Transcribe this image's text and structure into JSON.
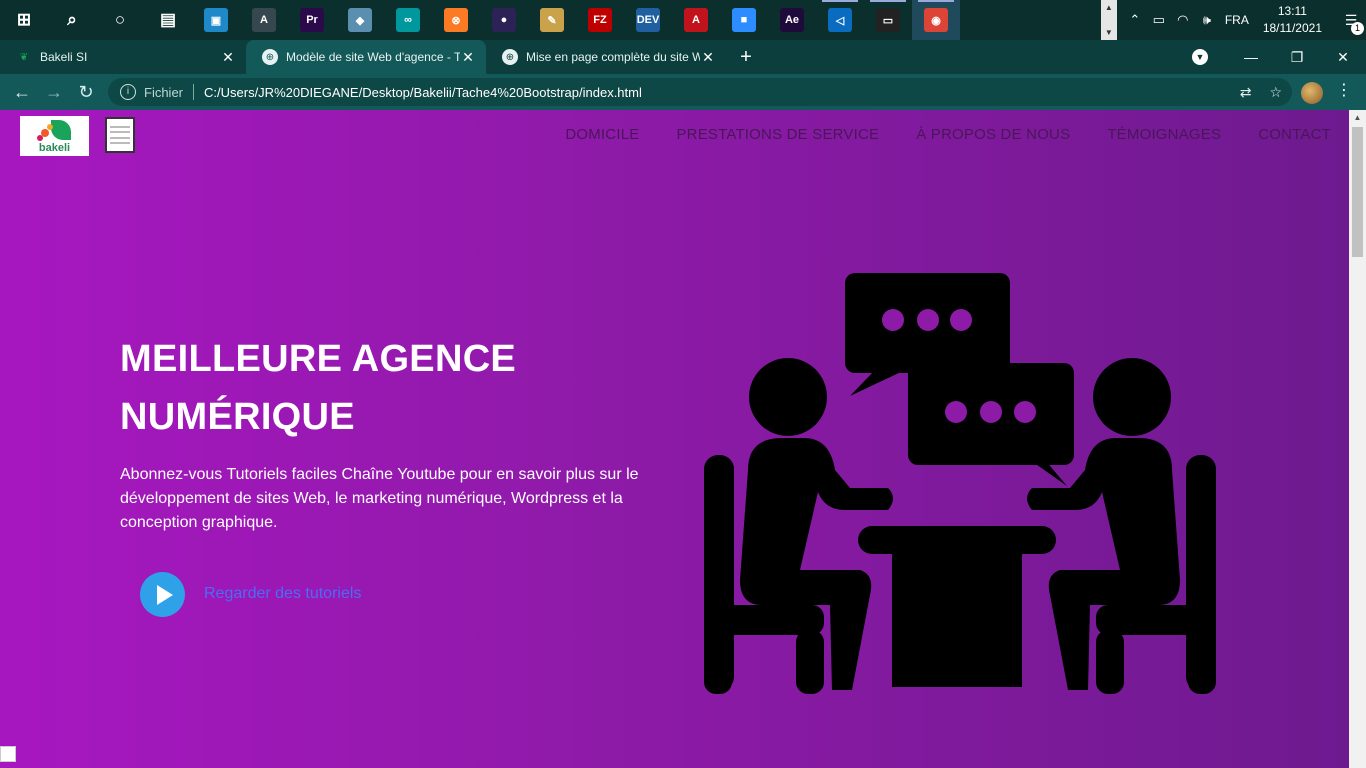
{
  "taskbar": {
    "apps": [
      {
        "name": "start",
        "glyph": "⊞",
        "color": "transparent"
      },
      {
        "name": "search",
        "glyph": "⌕",
        "color": "transparent"
      },
      {
        "name": "cortana",
        "glyph": "○",
        "color": "transparent"
      },
      {
        "name": "task-view",
        "glyph": "▤",
        "color": "transparent"
      },
      {
        "name": "app-1",
        "glyph": "▣",
        "color": "#1e88c8"
      },
      {
        "name": "app-2",
        "glyph": "A",
        "color": "#37474f"
      },
      {
        "name": "premiere",
        "glyph": "Pr",
        "color": "#2a0a4a"
      },
      {
        "name": "app-4",
        "glyph": "◆",
        "color": "#5a8fb0"
      },
      {
        "name": "arduino",
        "glyph": "∞",
        "color": "#00979d"
      },
      {
        "name": "xampp",
        "glyph": "⊗",
        "color": "#fb7a24"
      },
      {
        "name": "eclipse",
        "glyph": "●",
        "color": "#2c2255"
      },
      {
        "name": "app-8",
        "glyph": "✎",
        "color": "#c9a24a"
      },
      {
        "name": "filezilla",
        "glyph": "FZ",
        "color": "#bf0000"
      },
      {
        "name": "dev-cpp",
        "glyph": "DEV",
        "color": "#2060a0"
      },
      {
        "name": "acrobat",
        "glyph": "A",
        "color": "#c0131b"
      },
      {
        "name": "zoom",
        "glyph": "■",
        "color": "#2d8cff"
      },
      {
        "name": "after-effects",
        "glyph": "Ae",
        "color": "#1f0a3c"
      },
      {
        "name": "vscode",
        "glyph": "◁",
        "color": "#0a6cc0"
      },
      {
        "name": "terminal",
        "glyph": "▭",
        "color": "#222"
      },
      {
        "name": "chrome",
        "glyph": "◉",
        "color": "#db4437"
      }
    ],
    "tray": {
      "lang": "FRA",
      "time": "13:11",
      "date": "18/11/2021",
      "notif_count": "1"
    }
  },
  "browser": {
    "tabs": [
      {
        "title": "Bakeli SI"
      },
      {
        "title": "Modèle de site Web d'agence - T"
      },
      {
        "title": "Mise en page complète du site W"
      }
    ],
    "scheme": "Fichier",
    "url": "C:/Users/JR%20DIEGANE/Desktop/Bakelii/Tache4%20Bootstrap/index.html"
  },
  "site": {
    "brand": "bakeli",
    "nav": [
      "DOMICILE",
      "PRESTATIONS DE SERVICE",
      "À PROPOS DE NOUS",
      "TÉMOIGNAGES",
      "CONTACT"
    ],
    "hero": {
      "title_line1": "MEILLEURE AGENCE",
      "title_line2": "NUMÉRIQUE",
      "text": "Abonnez-vous Tutoriels faciles Chaîne Youtube pour en savoir plus sur le développement de sites Web, le marketing numérique, Wordpress et la conception graphique.",
      "cta": "Regarder des tutoriels"
    }
  }
}
